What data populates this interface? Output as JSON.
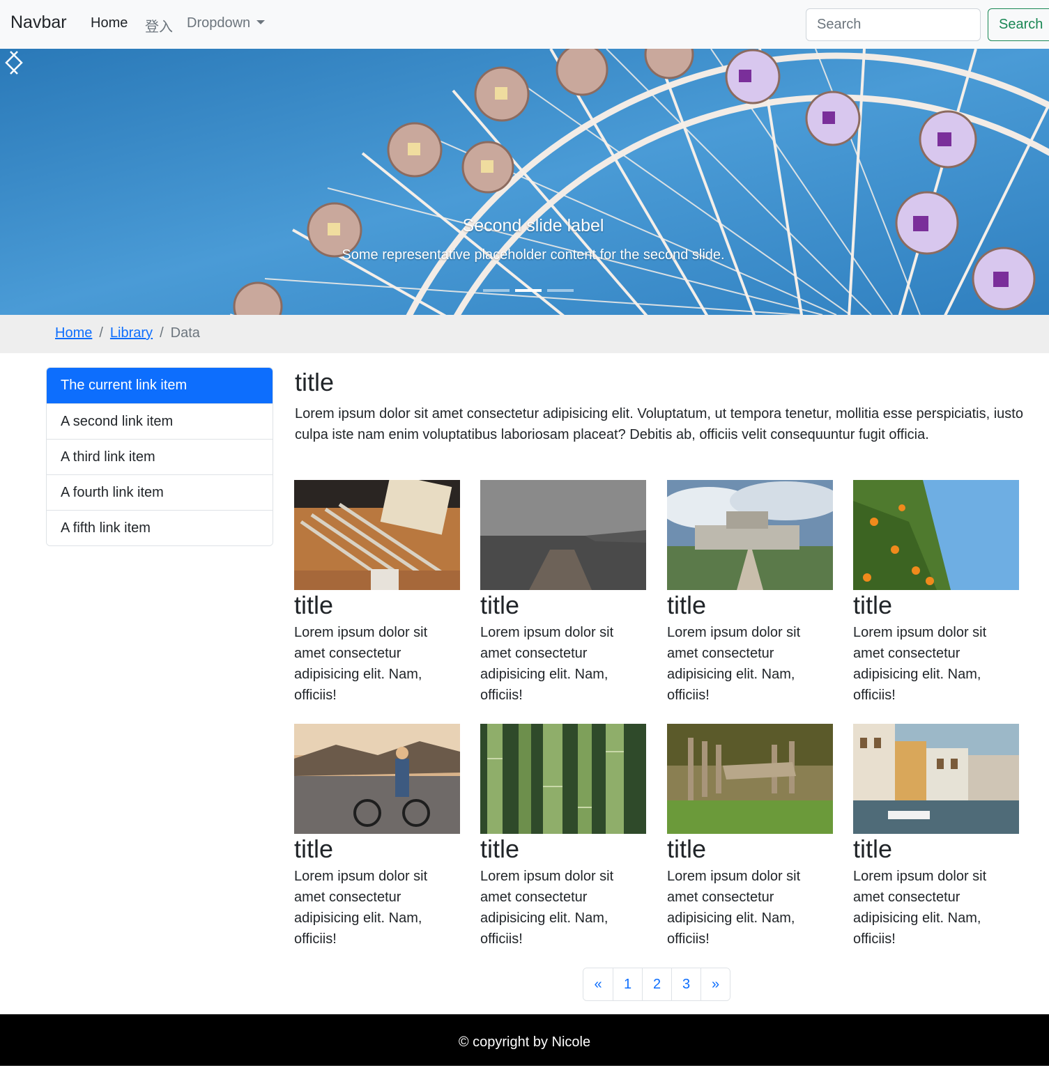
{
  "navbar": {
    "brand": "Navbar",
    "links": [
      {
        "label": "Home"
      },
      {
        "label": "登入"
      },
      {
        "label": "Dropdown"
      }
    ],
    "search_placeholder": "Search",
    "search_button": "Search"
  },
  "carousel": {
    "slide_title": "Second slide label",
    "slide_text": "Some representative placeholder content for the second slide.",
    "indicator_count": 3,
    "active_indicator": 2
  },
  "breadcrumb": {
    "items": [
      "Home",
      "Library",
      "Data"
    ],
    "separator": "/"
  },
  "sidebar": {
    "items": [
      {
        "label": "The current link item"
      },
      {
        "label": "A second link item"
      },
      {
        "label": "A third link item"
      },
      {
        "label": "A fourth link item"
      },
      {
        "label": "A fifth link item"
      }
    ]
  },
  "main": {
    "title": "title",
    "text": "Lorem ipsum dolor sit amet consectetur adipisicing elit. Voluptatum, ut tempora tenetur, mollitia esse perspiciatis, iusto culpa iste nam enim voluptatibus laboriosam placeat? Debitis ab, officiis velit consequuntur fugit officia."
  },
  "cards": [
    {
      "title": "title",
      "text": "Lorem ipsum dolor sit amet consectetur adipisicing elit. Nam, officiis!",
      "image": "pencils-photo"
    },
    {
      "title": "title",
      "text": "Lorem ipsum dolor sit amet consectetur adipisicing elit. Nam, officiis!",
      "image": "foggy-pier-photo"
    },
    {
      "title": "title",
      "text": "Lorem ipsum dolor sit amet consectetur adipisicing elit. Nam, officiis!",
      "image": "castle-photo"
    },
    {
      "title": "title",
      "text": "Lorem ipsum dolor sit amet consectetur adipisicing elit. Nam, officiis!",
      "image": "orange-tree-photo"
    },
    {
      "title": "title",
      "text": "Lorem ipsum dolor sit amet consectetur adipisicing elit. Nam, officiis!",
      "image": "cyclist-photo"
    },
    {
      "title": "title",
      "text": "Lorem ipsum dolor sit amet consectetur adipisicing elit. Nam, officiis!",
      "image": "bamboo-photo"
    },
    {
      "title": "title",
      "text": "Lorem ipsum dolor sit amet consectetur adipisicing elit. Nam, officiis!",
      "image": "old-dock-photo"
    },
    {
      "title": "title",
      "text": "Lorem ipsum dolor sit amet consectetur adipisicing elit. Nam, officiis!",
      "image": "canal-houses-photo"
    }
  ],
  "pagination": {
    "prev": "«",
    "pages": [
      "1",
      "2",
      "3"
    ],
    "next": "»"
  },
  "footer": {
    "text": "© copyright by Nicole"
  },
  "colors": {
    "primary": "#0d6efd",
    "success": "#198754",
    "navbar_bg": "#f8f9fa",
    "breadcrumb_bg": "#eeeeee",
    "footer_bg": "#000000"
  }
}
